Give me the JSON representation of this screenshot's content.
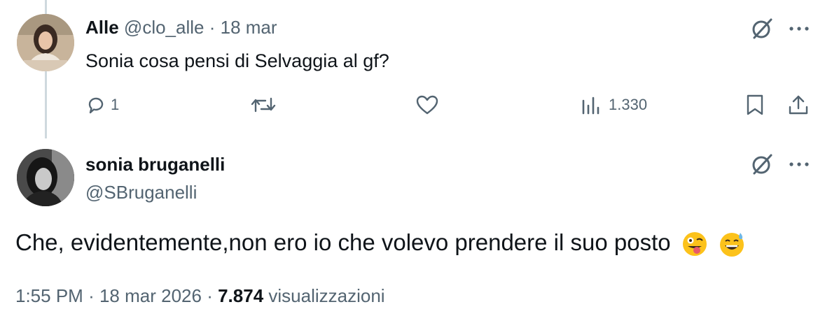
{
  "reply_parent": {
    "author_name": "Alle",
    "handle": "@clo_alle",
    "separator": "·",
    "date": "18 mar",
    "text": "Sonia cosa pensi di Selvaggia al gf?",
    "actions": {
      "reply_count": "1",
      "views_count": "1.330"
    }
  },
  "main_tweet": {
    "author_name": "sonia bruganelli",
    "handle": "@SBruganelli",
    "text": "Che, evidentemente,non ero io che volevo prendere il suo posto",
    "emojis": [
      "winking-face-with-tongue",
      "grinning-face-with-sweat"
    ],
    "time": "1:55 PM",
    "separator": "·",
    "date": "18 mar 2026",
    "views_count": "7.874",
    "views_label": "visualizzazioni"
  },
  "colors": {
    "text": "#0f1419",
    "muted": "#536471",
    "thread_line": "#cfd9de",
    "background": "#ffffff"
  },
  "icons": [
    "grok-icon",
    "more-icon",
    "reply-icon",
    "retweet-icon",
    "like-icon",
    "views-icon",
    "bookmark-icon",
    "share-icon"
  ]
}
